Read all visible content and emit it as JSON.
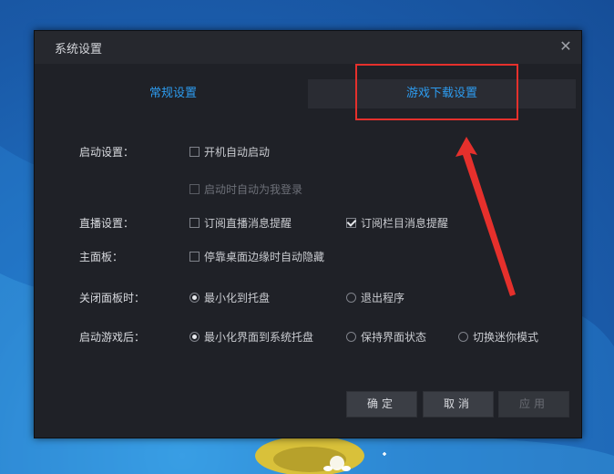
{
  "window": {
    "title": "系统设置",
    "close_glyph": "✕"
  },
  "tabs": [
    {
      "label": "常规设置",
      "active": true
    },
    {
      "label": "游戏下载设置",
      "active": false
    }
  ],
  "settings": {
    "startup": {
      "label": "启动设置：",
      "options": [
        {
          "label": "开机自动启动",
          "checked": false,
          "enabled": true
        },
        {
          "label": "启动时自动为我登录",
          "checked": false,
          "enabled": false
        }
      ]
    },
    "live": {
      "label": "直播设置：",
      "options": [
        {
          "label": "订阅直播消息提醒",
          "checked": false
        },
        {
          "label": "订阅栏目消息提醒",
          "checked": true
        }
      ]
    },
    "panel": {
      "label": "主面板：",
      "options": [
        {
          "label": "停靠桌面边缘时自动隐藏",
          "checked": false
        }
      ]
    },
    "close_panel": {
      "label": "关闭面板时：",
      "options": [
        {
          "label": "最小化到托盘",
          "selected": true
        },
        {
          "label": "退出程序",
          "selected": false
        }
      ]
    },
    "after_launch": {
      "label": "启动游戏后：",
      "options": [
        {
          "label": "最小化界面到系统托盘",
          "selected": true
        },
        {
          "label": "保持界面状态",
          "selected": false
        },
        {
          "label": "切换迷你模式",
          "selected": false
        }
      ]
    }
  },
  "buttons": {
    "ok": "确定",
    "cancel": "取消",
    "apply": "应用"
  },
  "colors": {
    "accent": "#2d9cf0",
    "annotation": "#e5302c",
    "dialog_bg": "#1f2127"
  }
}
